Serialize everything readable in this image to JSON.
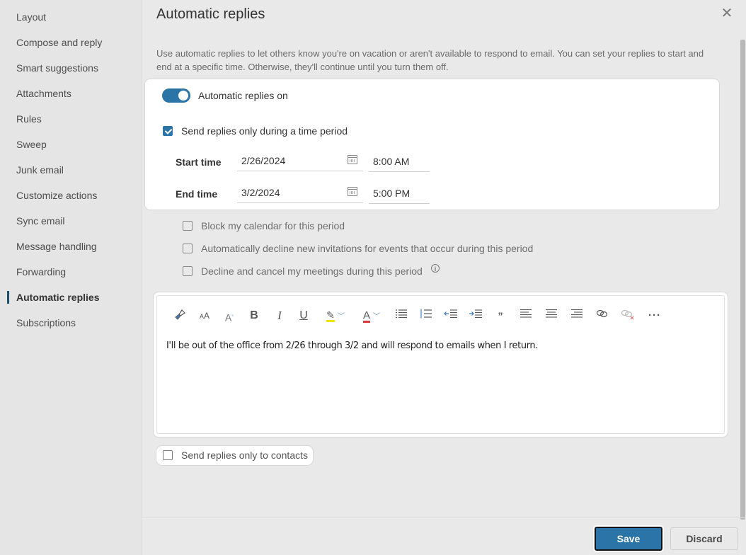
{
  "sidebar": {
    "items": [
      {
        "label": "Layout"
      },
      {
        "label": "Compose and reply"
      },
      {
        "label": "Smart suggestions"
      },
      {
        "label": "Attachments"
      },
      {
        "label": "Rules"
      },
      {
        "label": "Sweep"
      },
      {
        "label": "Junk email"
      },
      {
        "label": "Customize actions"
      },
      {
        "label": "Sync email"
      },
      {
        "label": "Message handling"
      },
      {
        "label": "Forwarding"
      },
      {
        "label": "Automatic replies",
        "active": true
      },
      {
        "label": "Subscriptions"
      }
    ]
  },
  "header": {
    "title": "Automatic replies",
    "close_icon": "close-icon",
    "description": "Use automatic replies to let others know you're on vacation or aren't available to respond to email. You can set your replies to start and end at a specific time. Otherwise, they'll continue until you turn them off."
  },
  "settings": {
    "toggle_label": "Automatic replies on",
    "toggle_on": true,
    "time_period_label": "Send replies only during a time period",
    "time_period_checked": true,
    "start_label": "Start time",
    "start_date": "2/26/2024",
    "start_time": "8:00 AM",
    "end_label": "End time",
    "end_date": "3/2/2024",
    "end_time": "5:00 PM",
    "options": [
      {
        "label": "Block my calendar for this period",
        "checked": false
      },
      {
        "label": "Automatically decline new invitations for events that occur during this period",
        "checked": false
      },
      {
        "label": "Decline and cancel my meetings during this period",
        "checked": false,
        "info": true
      }
    ]
  },
  "editor": {
    "toolbar": [
      {
        "name": "format-painter-icon",
        "glyph": "🖌"
      },
      {
        "name": "font-size-icon",
        "glyph": "ᴬA"
      },
      {
        "name": "text-effects-icon",
        "glyph": "A°"
      },
      {
        "name": "bold-icon",
        "glyph": "B"
      },
      {
        "name": "italic-icon",
        "glyph": "I"
      },
      {
        "name": "underline-icon",
        "glyph": "U"
      },
      {
        "name": "highlight-icon",
        "glyph": "✎"
      },
      {
        "name": "font-color-icon",
        "glyph": "A"
      },
      {
        "name": "bullets-icon",
        "glyph": "☰"
      },
      {
        "name": "numbering-icon",
        "glyph": "☰"
      },
      {
        "name": "decrease-indent-icon",
        "glyph": "⇤"
      },
      {
        "name": "increase-indent-icon",
        "glyph": "⇥"
      },
      {
        "name": "quote-icon",
        "glyph": "❞"
      },
      {
        "name": "align-left-icon",
        "glyph": "≡"
      },
      {
        "name": "align-center-icon",
        "glyph": "≡"
      },
      {
        "name": "align-right-icon",
        "glyph": "≡"
      },
      {
        "name": "link-icon",
        "glyph": "🔗"
      },
      {
        "name": "remove-link-icon",
        "glyph": "⛓"
      },
      {
        "name": "more-options-icon",
        "glyph": "···"
      }
    ],
    "body": "I'll be out of the office from 2/26 through 3/2 and will respond to emails when I return.",
    "highlight_color": "#f2e600",
    "font_color": "#d93a3a"
  },
  "contacts_only_label": "Send replies only to contacts",
  "contacts_only_checked": false,
  "footer": {
    "save_label": "Save",
    "discard_label": "Discard"
  },
  "colors": {
    "accent": "#2a74a8"
  }
}
